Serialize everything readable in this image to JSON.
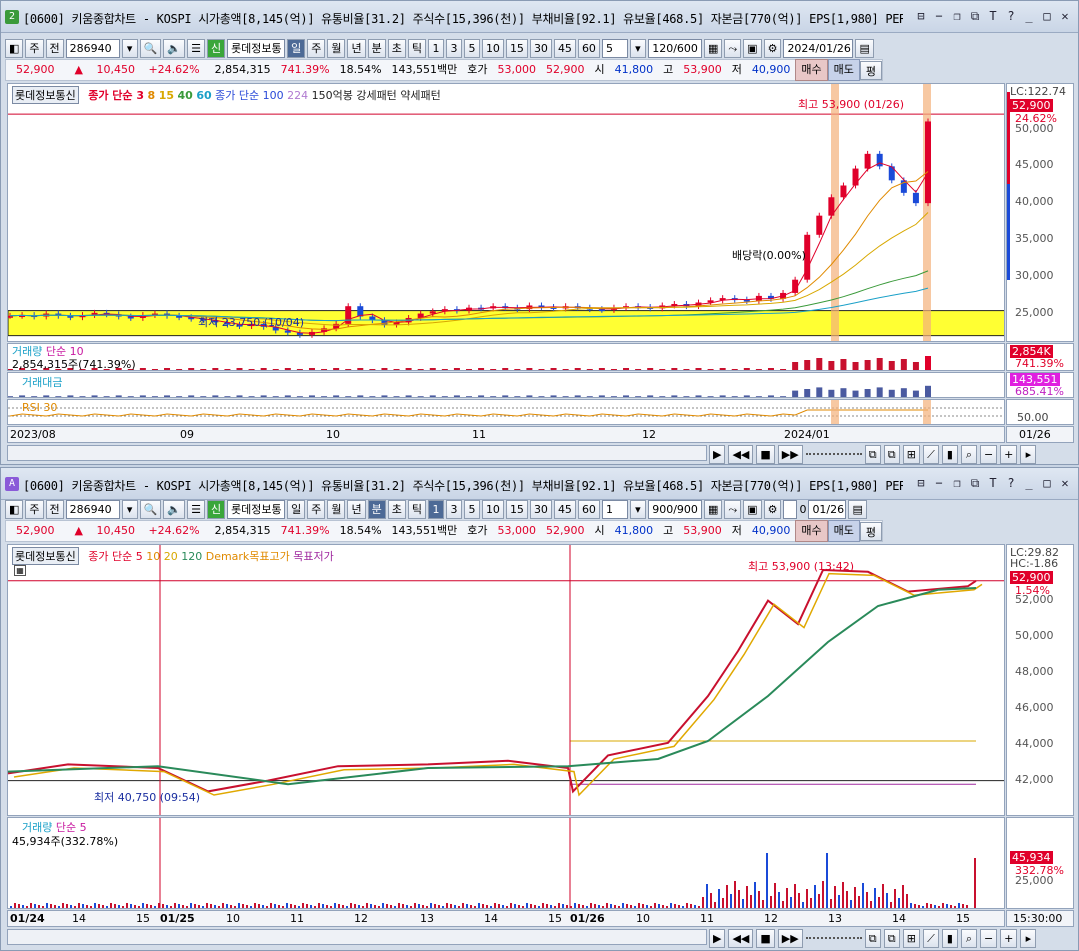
{
  "w1": {
    "badge": "2",
    "title": "[0600] 키움종합차트 - KOSPI 시가총액[8,145(억)] 유통비율[31.2] 주식수[15,396(천)] 부채비율[92.1] 유보율[468.5] 자본금[770(억)] EPS[1,980] PER[26.7",
    "toolbar": {
      "period": "주",
      "prev": "전",
      "code": "286940",
      "name": "롯데정보통",
      "sin": "신",
      "tabs": [
        "일",
        "주",
        "월",
        "년",
        "분",
        "초",
        "틱"
      ],
      "nums": [
        "1",
        "3",
        "5",
        "10",
        "15",
        "30",
        "45",
        "60"
      ],
      "step": "5",
      "count": "120/600",
      "date": "2024/01/26"
    },
    "legend": {
      "name": "롯데정보통신",
      "ma": "종가 단순 3",
      "ma2": "8",
      "ma3": "15",
      "ma4": "40",
      "ma5": "60",
      "ma6": "종가 단순 100",
      "ma7": "224",
      "ma8": "150억봉 강세패턴",
      "ma9": "약세패턴"
    },
    "anno": {
      "high": "최고 53,900 (01/26)",
      "low": "최저 23,750 (10/04)",
      "div": "배당락(0.00%)"
    },
    "yaxis": {
      "lc": "LC:122.74",
      "cur": "52,900",
      "pct": "24.62%",
      "ticks": [
        "50,000",
        "45,000",
        "40,000",
        "35,000",
        "30,000",
        "25,000"
      ]
    },
    "vol": {
      "label": "거래량",
      "ma": "단순 10",
      "val": "2,854,315주(741.39%)",
      "tag": "2,854K",
      "pct": "741.39%"
    },
    "amt": {
      "label": "거래대금",
      "tag": "143,551",
      "pct": "685.41%"
    },
    "rsi": {
      "label": "RSI 30",
      "tick": "50.00"
    },
    "xaxis": {
      "ticks": [
        "2023/08",
        "09",
        "10",
        "11",
        "12",
        "2024/01"
      ],
      "last": "01/26"
    },
    "close_series": [
      26.5,
      26.6,
      26.4,
      26.8,
      26.5,
      26.3,
      26.6,
      26.9,
      26.7,
      26.4,
      26.2,
      26.6,
      26.8,
      26.5,
      26.3,
      26.1,
      25.9,
      25.6,
      25.3,
      25.1,
      25.4,
      25.0,
      24.5,
      24.2,
      23.9,
      24.3,
      24.8,
      25.4,
      27.8,
      26.4,
      25.9,
      25.3,
      25.6,
      26.2,
      26.8,
      27.1,
      27.4,
      27.2,
      27.6,
      27.5,
      27.8,
      27.6,
      27.4,
      27.9,
      27.7,
      27.5,
      27.8,
      27.6,
      27.4,
      27.3,
      27.6,
      27.8,
      27.7,
      27.5,
      27.9,
      28.1,
      27.8,
      28.3,
      28.6,
      28.9,
      28.7,
      28.5,
      29.2,
      28.8,
      29.6,
      31.4,
      37.5,
      40.1,
      42.6,
      44.2,
      46.5,
      48.5,
      46.8,
      44.9,
      43.2,
      41.8,
      52.9
    ]
  },
  "w2": {
    "badge": "A",
    "title": "[0600] 키움종합차트 - KOSPI 시가총액[8,145(억)] 유통비율[31.2] 주식수[15,396(천)] 부채비율[92.1] 유보율[468.5] 자본금[770(억)] EPS[1,980] PER[26.7",
    "toolbar": {
      "period": "주",
      "prev": "전",
      "code": "286940",
      "name": "롯데정보통",
      "sin": "신",
      "tabs": [
        "일",
        "주",
        "월",
        "년",
        "분",
        "초",
        "틱"
      ],
      "nums": [
        "1",
        "3",
        "5",
        "10",
        "15",
        "30",
        "45",
        "60"
      ],
      "step": "1",
      "count": "900/900",
      "chk": "0",
      "date": "01/26"
    },
    "legend": {
      "name": "롯데정보통신",
      "ma": "종가 단순 5",
      "ma2": "10",
      "ma3": "20",
      "ma4": "120",
      "dm1": "Demark목표고가",
      "dm2": "목표저가"
    },
    "anno": {
      "high": "최고 53,900 (13:42)",
      "low": "최저 40,750 (09:54)"
    },
    "yaxis": {
      "lc": "LC:29.82",
      "hc": "HC:-1.86",
      "cur": "52,900",
      "pct": "1.54%",
      "ticks": [
        "52,000",
        "50,000",
        "48,000",
        "46,000",
        "44,000",
        "42,000"
      ]
    },
    "vol": {
      "label": "거래량",
      "ma": "단순 5",
      "val": "45,934주(332.78%)",
      "tag": "45,934",
      "pct": "332.78%",
      "tick": "25,000"
    },
    "xaxis": {
      "ticks": [
        "01/24",
        "14",
        "15",
        "01/25",
        "10",
        "11",
        "12",
        "13",
        "14",
        "15",
        "01/26",
        "10",
        "11",
        "12",
        "13",
        "14",
        "15"
      ],
      "last": "15:30:00"
    }
  },
  "quote": {
    "price": "52,900",
    "arrow": "▲",
    "chg": "10,450",
    "rate": "+24.62%",
    "vol": "2,854,315",
    "volpct": "741.39%",
    "turn": "18.54%",
    "amt": "143,551백만",
    "hoga_l": "호가",
    "hoga": "53,000",
    "ask": "52,900",
    "open_l": "시",
    "open": "41,800",
    "high_l": "고",
    "high": "53,900",
    "low_l": "저",
    "low": "40,900",
    "buy": "매수",
    "sell": "매도",
    "avg": "평"
  }
}
